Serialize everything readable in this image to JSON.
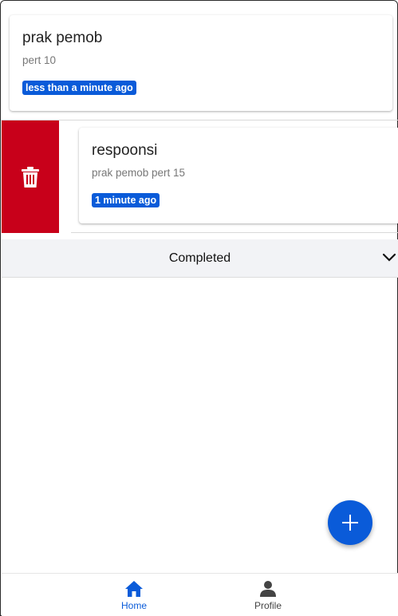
{
  "tasks": [
    {
      "title": "prak pemob",
      "subtitle": "pert 10",
      "time": "less than a minute ago"
    },
    {
      "title": "respoonsi",
      "subtitle": "prak pemob pert 15",
      "time": "1 minute ago"
    }
  ],
  "completed_section": {
    "label": "Completed",
    "icon": "chevron-down-icon"
  },
  "fab": {
    "icon": "plus-icon"
  },
  "bottom_nav": [
    {
      "label": "Home",
      "icon": "home-icon",
      "active": true
    },
    {
      "label": "Profile",
      "icon": "person-icon",
      "active": false
    }
  ],
  "colors": {
    "accent": "#0a5bd9",
    "delete": "#c8001a",
    "section_bg": "#f2f3f6"
  }
}
